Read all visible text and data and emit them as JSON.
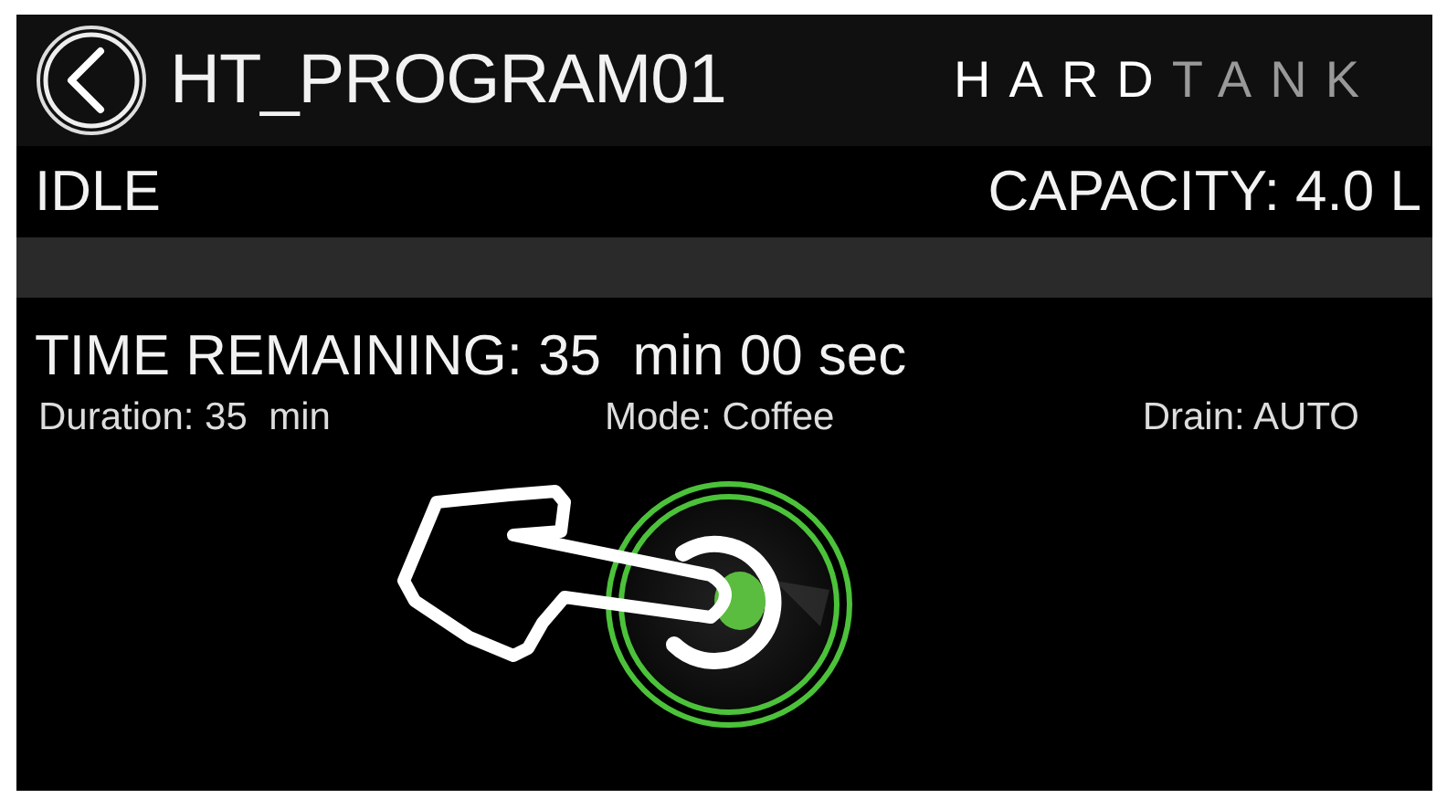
{
  "header": {
    "title": "HT_PROGRAM01",
    "logo": {
      "first": "HARD",
      "second": "TANK"
    }
  },
  "status": {
    "state": "IDLE",
    "capacity": "CAPACITY: 4.0 L"
  },
  "time_remaining": "TIME REMAINING: 35  min 00 sec",
  "details": [
    {
      "text": "Duration: 35  min"
    },
    {
      "text": "Mode: Coffee"
    },
    {
      "text": "Drain: AUTO"
    }
  ]
}
